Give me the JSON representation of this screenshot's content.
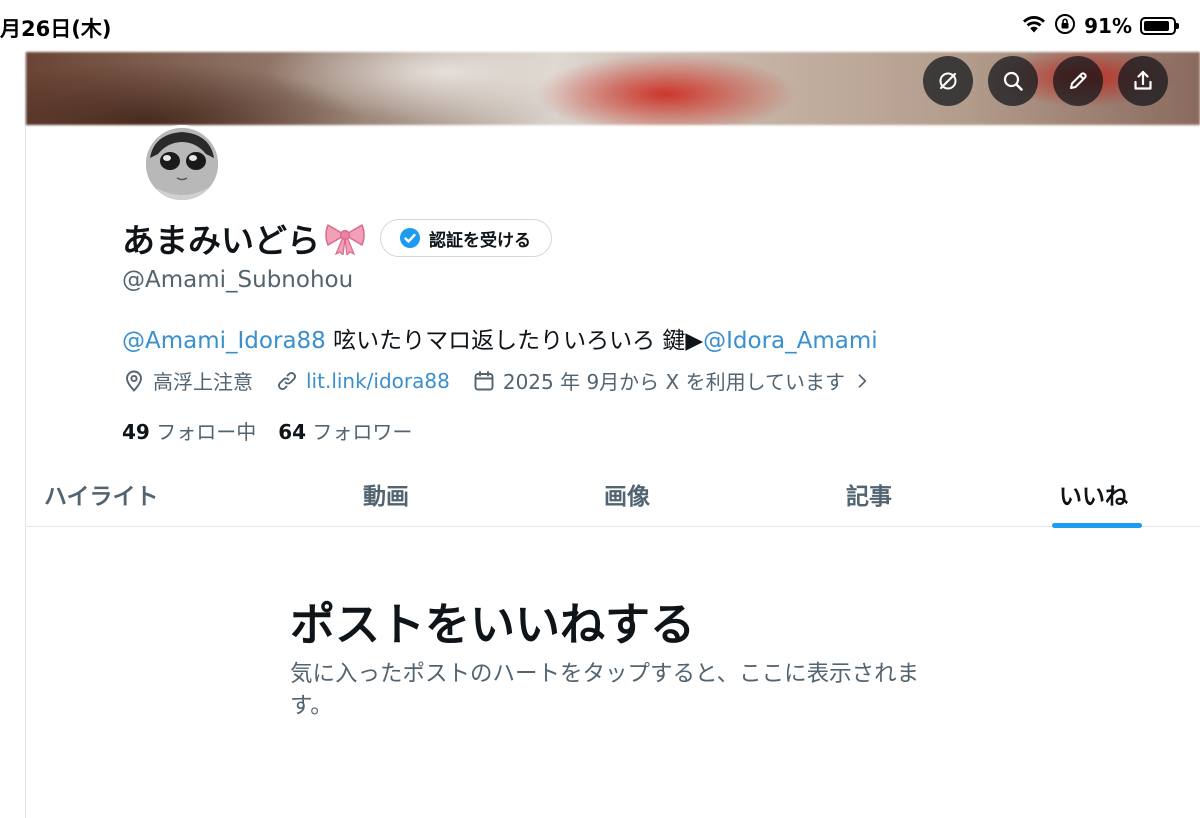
{
  "status_bar": {
    "date": "月26日(木)",
    "battery_percent": "91%",
    "battery_level": 0.91,
    "icons": [
      "wifi-icon",
      "orientation-lock-icon",
      "battery-icon"
    ]
  },
  "banner": {
    "actions": [
      "grok-icon",
      "search-icon",
      "edit-icon",
      "share-icon"
    ]
  },
  "profile": {
    "display_name": "あまみいどら",
    "name_emoji": "ribbon-icon",
    "verify_label": "認証を受ける",
    "handle": "@Amami_Subnohou",
    "bio": {
      "mention_1": "@Amami_Idora88",
      "text": " 呟いたりマロ返したりいろいろ 鍵▶",
      "mention_2": "@Idora_Amami"
    },
    "location": "高浮上注意",
    "website": "lit.link/idora88",
    "joined": "2025 年 9月から X を利用しています",
    "following_count": "49",
    "following_label": "フォロー中",
    "followers_count": "64",
    "followers_label": "フォロワー"
  },
  "tabs": [
    {
      "label": "ハイライト",
      "active": false
    },
    {
      "label": "動画",
      "active": false
    },
    {
      "label": "画像",
      "active": false
    },
    {
      "label": "記事",
      "active": false
    },
    {
      "label": "いいね",
      "active": true
    }
  ],
  "empty_state": {
    "title": "ポストをいいねする",
    "description": "気に入ったポストのハートをタップすると、ここに表示されます。"
  },
  "colors": {
    "accent": "#1d9bf0",
    "text_primary": "#0f1419",
    "text_secondary": "#536471",
    "verified_badge": "#1d9bf0"
  }
}
